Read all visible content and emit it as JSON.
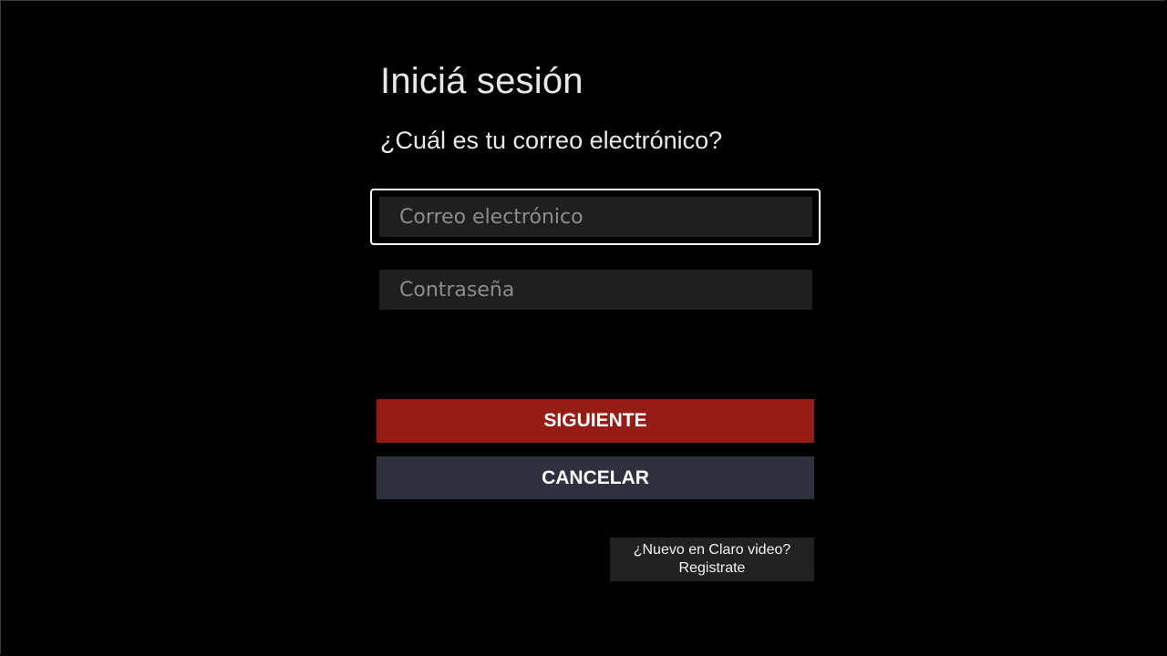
{
  "login": {
    "title": "Iniciá sesión",
    "question": "¿Cuál es tu correo electrónico?",
    "email_placeholder": "Correo electrónico",
    "password_placeholder": "Contraseña",
    "next_label": "SIGUIENTE",
    "cancel_label": "CANCELAR",
    "register_line1": "¿Nuevo en Claro video?",
    "register_line2": "Registrate"
  },
  "colors": {
    "background": "#000000",
    "primary_button": "#981c16",
    "secondary_button": "#2e3140",
    "field_background": "#1f1f1f",
    "focus_border": "#ffffff"
  }
}
